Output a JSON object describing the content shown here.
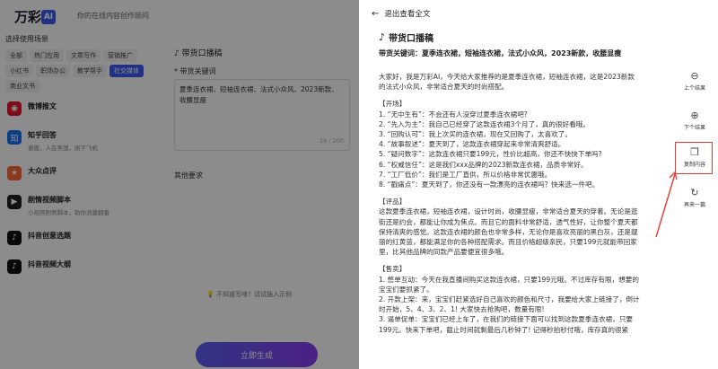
{
  "header": {
    "logo_mark": "AI",
    "logo_name": "万彩",
    "tagline": "你的在线内容创作顾问"
  },
  "sidebar": {
    "section_title": "选择使用场景",
    "tags": [
      {
        "label": "全部",
        "active": false
      },
      {
        "label": "热门应用",
        "active": false
      },
      {
        "label": "文章写作",
        "active": false
      },
      {
        "label": "营销推广",
        "active": false
      },
      {
        "label": "小红书",
        "active": false
      },
      {
        "label": "职场办公",
        "active": false
      },
      {
        "label": "教学帮手",
        "active": false
      },
      {
        "label": "社交媒体",
        "active": true
      },
      {
        "label": "商业文书",
        "active": false
      }
    ],
    "scenes": [
      {
        "title": "微博推文",
        "desc": "",
        "icon": "weibo-icon",
        "color": "#e6162d"
      },
      {
        "title": "知乎回答",
        "desc": "谢邀，人在美国，刚下飞机",
        "icon": "zhihu-icon",
        "color": "#1772f6"
      },
      {
        "title": "大众点评",
        "desc": "",
        "icon": "dianping-icon",
        "color": "#ff6633"
      },
      {
        "title": "剧情视频脚本",
        "desc": "小视频剧情脚本，助你流量翻番",
        "icon": "video-icon",
        "color": "#222222"
      },
      {
        "title": "抖音创意选题",
        "desc": "",
        "icon": "douyin-icon",
        "color": "#111111"
      },
      {
        "title": "抖音视频大纲",
        "desc": "",
        "icon": "douyin-icon",
        "color": "#111111"
      }
    ]
  },
  "form": {
    "title": "带货口播稿",
    "keyword_label": "* 带货关键词",
    "keyword_value": "夏季连衣裙、短袖连衣裙、法式小众风、2023新款、收腰显瘦",
    "keyword_count": "29 / 200",
    "other_label": "其他要求",
    "hint": "不知道写啥？试试插入示例",
    "generate_label": "立即生成"
  },
  "panel": {
    "exit_label": "退出查看全文",
    "doc_title": "带货口播稿",
    "keywords_line": "带货关键词：夏季连衣裙，短袖连衣裙，法式小众风，2023新款，收腰显瘦",
    "intro": [
      "大家好，我是万彩AI，今天给大家推荐的是夏季连衣裙，短袖连衣裙，这是2023新款",
      "的法式小众风，非常适合夏天的时尚搭配。"
    ],
    "opening_title": "【开场】",
    "opening": [
      "1. “无中生有”：不会还有人没穿过夏季连衣裙吧?",
      "2. “先入为主”：我自己已经穿了这款连衣裙3个月了，真的很好看哦。",
      "3. “回购认可”：我上次买的连衣裙，现在又回购了，太喜欢了。",
      "4. “故事叙述”：夏天到了，这款连衣裙穿起来非常清爽舒适。",
      "5. “疑问数字”：这款连衣裙只要199元，性价比超高，你还不快快下单吗?",
      "6. “权威信任”：这是我们xxx品牌的2023新款连衣裙，品质非常好。",
      "7. “工厂低价”：我们是工厂直供，所以价格非常优惠哦。",
      "8. “戳痛点”：夏天到了，你还没有一款漂亮的连衣裙吗？快来选一件吧。"
    ],
    "review_title": "【评品】",
    "review": [
      "这款夏季连衣裙，短袖连衣裙，设计时尚，收腰显瘦，非常适合夏天的穿着。无论是逛",
      "街还是约会，都能让你成为焦点。而且它的面料非常舒适，透气性好，让你整个夏天都",
      "保持清爽的感觉。这款连衣裙的颜色也非常多样，无论你是喜欢亮丽的黑白灰，还是靓",
      "丽的红黄蓝，都能满足你的各种搭配需求。而且价格超级亲民，只要199元就能带回家",
      "里，比其他品牌的同款产品要便宜很多哦。"
    ],
    "sale_title": "【售卖】",
    "sale": [
      "1. 憋单互动：今天在我直播间购买这款连衣裙，只要199元哦。不过库存有限，想要的",
      "宝宝们要抓紧了。",
      "2. 开款上架：来，宝宝们赶紧选好自己喜欢的颜色和尺寸，我要给大家上链接了，倒计",
      "时开始，5、4、3、2、1! 大家快去抢购吧，数量有限!",
      "3. 逼单促单：宝宝们已经上车了，在我们的链接下面可以找到这款夏季连衣裙，只要",
      "199元。快来下单吧，截止时间就剩最后几秒钟了! 记得秒拍秒付哦，库存真的很紧"
    ]
  },
  "rail": {
    "prev": "上个结果",
    "next": "下个结果",
    "copy": "复制内容",
    "again": "再来一篇"
  }
}
